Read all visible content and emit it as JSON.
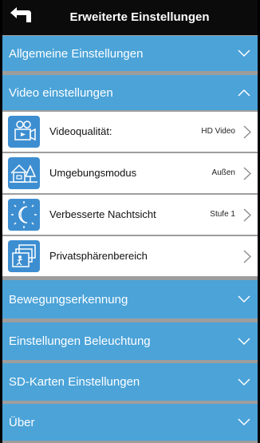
{
  "header": {
    "title": "Erweiterte Einstellungen",
    "back_icon": "back-arrow-icon"
  },
  "sections": [
    {
      "label": "Allgemeine Einstellungen",
      "expanded": false
    },
    {
      "label": "Video einstellungen",
      "expanded": true
    },
    {
      "label": "Bewegungserkennung",
      "expanded": false
    },
    {
      "label": "Einstellungen Beleuchtung",
      "expanded": false
    },
    {
      "label": "SD-Karten Einstellungen",
      "expanded": false
    },
    {
      "label": "Über",
      "expanded": false
    }
  ],
  "video_items": [
    {
      "label": "Videoqualität:",
      "value": "HD Video",
      "icon": "video-camera-icon"
    },
    {
      "label": "Umgebungsmodus",
      "value": "Außen",
      "icon": "house-tree-icon"
    },
    {
      "label": "Verbesserte Nachtsicht",
      "value": "Stufe 1",
      "icon": "moon-sun-icon"
    },
    {
      "label": "Privatsphärenbereich",
      "value": "",
      "icon": "privacy-zone-icon"
    }
  ],
  "colors": {
    "header_bg": "#0b0b0b",
    "section_bg": "#4ba3d8",
    "icon_bg": "#3d8ed1",
    "divider": "#9d9d9d",
    "item_bg": "#ffffff"
  }
}
